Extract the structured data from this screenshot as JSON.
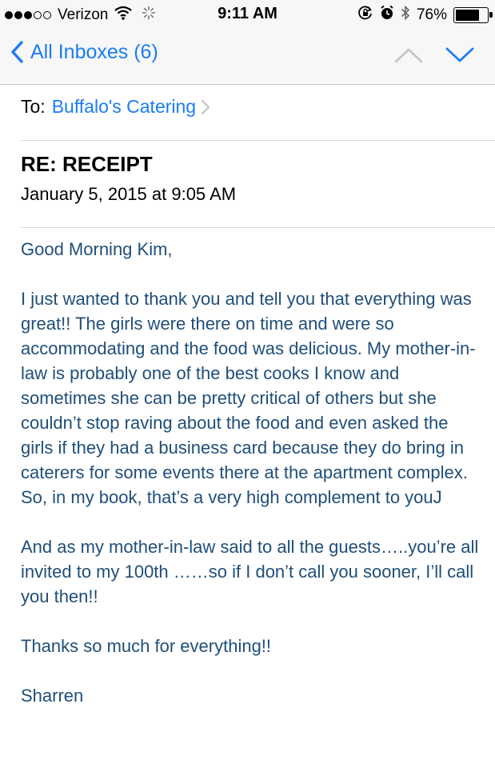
{
  "status_bar": {
    "carrier": "Verizon",
    "time": "9:11 AM",
    "battery_text": "76%",
    "battery_level": 0.76,
    "signal_bars_filled": 3,
    "signal_bars_total": 5,
    "icons": [
      "wifi-icon",
      "activity-spinner-icon",
      "orientation-lock-icon",
      "alarm-icon",
      "bluetooth-icon",
      "battery-icon"
    ]
  },
  "nav": {
    "back_label": "All Inboxes (6)",
    "icons": [
      "chevron-left-icon",
      "chevron-up-icon",
      "chevron-down-icon"
    ],
    "accent_color": "#1a7cf6"
  },
  "header": {
    "to_label": "To:",
    "to_name": "Buffalo's Catering",
    "subject": "RE: RECEIPT",
    "date": "January 5, 2015 at 9:05 AM"
  },
  "message": {
    "text_color": "#1f4e79",
    "paragraphs": [
      "Good Morning Kim,",
      "I just wanted to thank you and tell you that everything was great!! The girls were there on time and were so accommodating and the food was delicious.  My mother-in-law is probably one of the best cooks I know and sometimes she can be pretty critical of others but she couldn’t stop raving about the food and even asked the girls if they had a business card because they do bring in caterers for some events there at the apartment complex.  So, in my book, that’s a very high complement to youJ",
      "And as my mother-in-law said to all the guests…..you’re all invited to my 100th ……so if I don’t call you sooner, I’ll call you then!!",
      "Thanks so much for everything!!",
      "Sharren"
    ]
  }
}
